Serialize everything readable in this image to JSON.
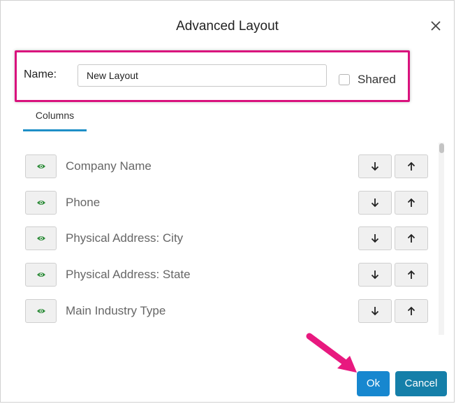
{
  "dialog": {
    "title": "Advanced Layout",
    "close_icon": "close-icon"
  },
  "name_field": {
    "label": "Name:",
    "value": "New Layout"
  },
  "shared": {
    "label": "Shared",
    "checked": false
  },
  "tabs": [
    {
      "label": "Columns",
      "active": true
    }
  ],
  "columns": [
    {
      "label": "Company Name",
      "visible": true
    },
    {
      "label": "Phone",
      "visible": true
    },
    {
      "label": "Physical Address: City",
      "visible": true
    },
    {
      "label": "Physical Address: State",
      "visible": true
    },
    {
      "label": "Main Industry Type",
      "visible": true
    }
  ],
  "footer": {
    "ok_label": "Ok",
    "cancel_label": "Cancel"
  },
  "colors": {
    "highlight": "#d9127d",
    "tab_accent": "#1e8fc7",
    "ok_button": "#1787cf",
    "cancel_button": "#157fa9",
    "eye_icon": "#2e8b3a"
  },
  "icons": {
    "visibility": "eye-icon",
    "move_down": "arrow-down-icon",
    "move_up": "arrow-up-icon",
    "annotation": "pink-arrow-annotation"
  }
}
